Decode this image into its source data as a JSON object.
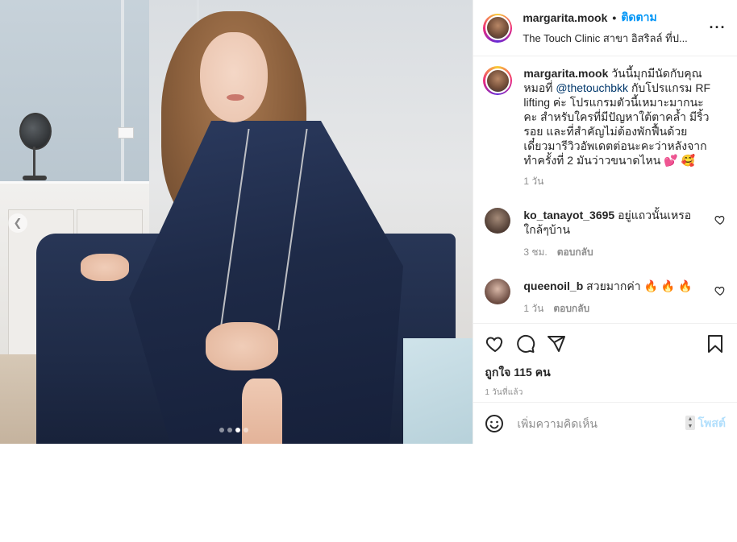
{
  "header": {
    "username": "margarita.mook",
    "separator": "•",
    "follow_label": "ติดตาม",
    "location": "The Touch Clinic สาขา อิสริลล์ ที่ป...",
    "more_icon": "more-horizontal-icon"
  },
  "caption": {
    "username": "margarita.mook",
    "text_before_mention": "วันนี้มุกมีนัดกับคุณหมอที่",
    "mention": "@thetouchbkk",
    "text_after_mention": "กับโปรแกรม RF lifting ค่ะ โปรแกรมตัวนี้เหมาะมากนะคะ สำหรับใครที่มีปัญหาใต้ตาคล้ำ มีริ้วรอย และที่สำคัญไม่ต้องพักฟื้นด้วย เดี๋ยวมารีวิวอัพเดตต่อนะคะว่าหลังจากทำครั้งที่ 2 มันว่าวขนาดไหน 💕 🥰",
    "time": "1 วัน"
  },
  "comments": [
    {
      "username": "ko_tanayot_3695",
      "text": "อยู่แถวนั้นเหรอใกล้ๆบ้าน",
      "time": "3 ชม.",
      "reply_label": "ตอบกลับ"
    },
    {
      "username": "queenoil_b",
      "text": "สวยมากค่า 🔥 🔥 🔥",
      "time": "1 วัน",
      "reply_label": "ตอบกลับ"
    }
  ],
  "actions": {
    "likes_text": "ถูกใจ 115 คน",
    "time_ago": "1 วันที่แล้ว"
  },
  "add_comment": {
    "placeholder": "เพิ่มความคิดเห็น",
    "post_label": "โพสต์"
  },
  "media": {
    "carousel_dots": 4,
    "active_dot": 2
  }
}
